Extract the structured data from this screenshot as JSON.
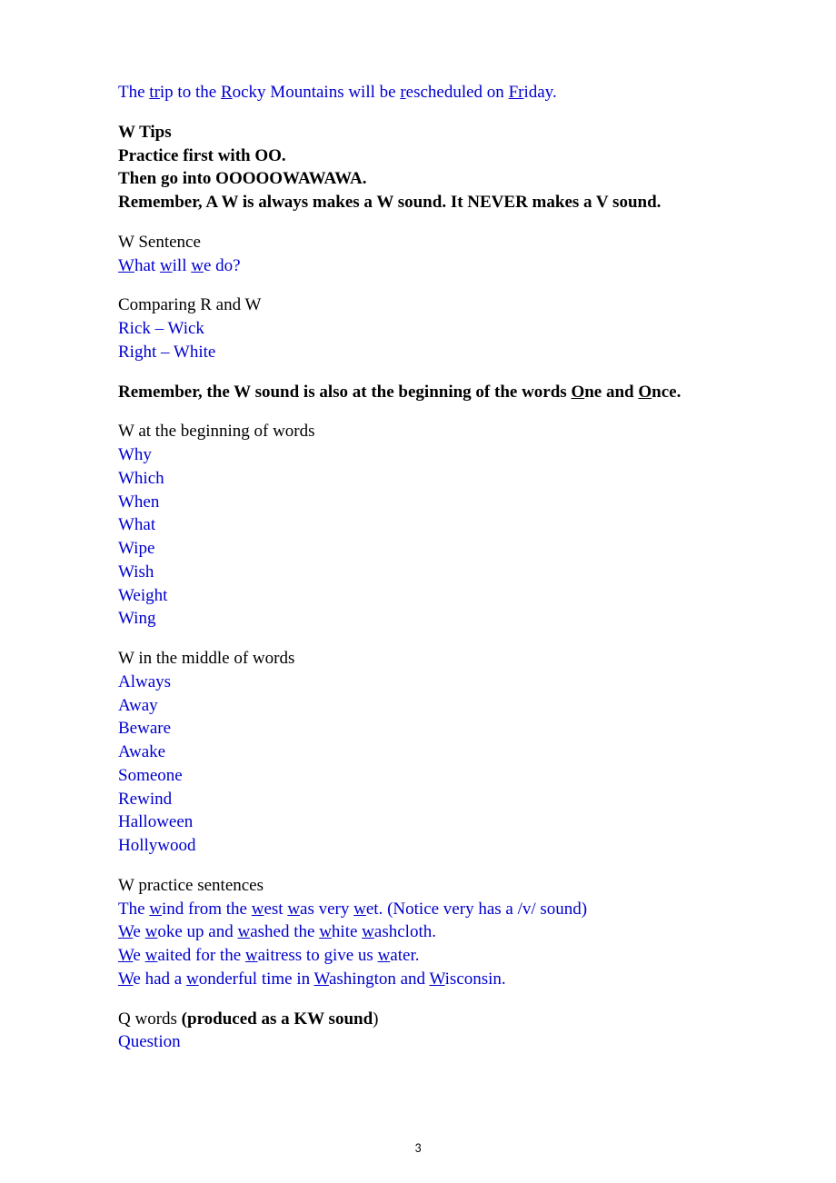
{
  "top_sentence": {
    "pre": "The ",
    "u1": "tr",
    "mid1": "ip to the ",
    "u2": "R",
    "mid2": "ocky Mountains will be ",
    "u3": "r",
    "mid3": "escheduled on ",
    "u4": "Fr",
    "mid4": "iday."
  },
  "w_tips": {
    "heading": "W Tips",
    "line1": "Practice first with OO.",
    "line2": "Then go into OOOOOWAWAWA.",
    "line3": "Remember, A W is always makes a W sound. It NEVER makes a V sound."
  },
  "w_sentence": {
    "heading": "W Sentence",
    "u1": "W",
    "t1": "hat ",
    "u2": "w",
    "t2": "ill ",
    "u3": "w",
    "t3": "e do?"
  },
  "comparing": {
    "heading": "Comparing R and W",
    "line1": "Rick – Wick",
    "line2": "Right – White"
  },
  "remember_w": {
    "pre": "Remember, the W sound is also at the beginning of the words ",
    "u1": "O",
    "mid1": "ne and ",
    "u2": "O",
    "mid2": "nce."
  },
  "w_beginning": {
    "heading": "W at the beginning of words",
    "words": [
      "Why",
      "Which",
      "When",
      "What",
      "Wipe",
      "Wish",
      "Weight",
      "Wing"
    ]
  },
  "w_middle": {
    "heading": "W in the middle of words",
    "words": [
      "Always",
      "Away",
      "Beware",
      "Awake",
      "Someone",
      "Rewind",
      "Halloween",
      "Hollywood"
    ]
  },
  "w_practice": {
    "heading": "W practice sentences",
    "s1": {
      "pre": "The ",
      "u1": "w",
      "t1": "ind from the ",
      "u2": "w",
      "t2": "est ",
      "u3": "w",
      "t3": "as very ",
      "u4": "w",
      "t4": "et. (Notice very has a /v/ sound)"
    },
    "s2": {
      "u1": "W",
      "t1": "e ",
      "u2": "w",
      "t2": "oke up and ",
      "u3": "w",
      "t3": "ashed the ",
      "u4": "w",
      "t4": "hite ",
      "u5": "w",
      "t5": "ashcloth."
    },
    "s3": {
      "u1": "W",
      "t1": "e ",
      "u2": "w",
      "t2": "aited for the ",
      "u3": "w",
      "t3": "aitress to give us ",
      "u4": "w",
      "t4": "ater."
    },
    "s4": {
      "u1": "W",
      "t1": "e had a ",
      "u2": "w",
      "t2": "onderful time in ",
      "u3": "W",
      "t3": "ashington and ",
      "u4": "W",
      "t4": "isconsin."
    }
  },
  "q_words": {
    "pre": "Q words ",
    "bold": "(produced as a KW sound",
    "post": ")",
    "word": "Question"
  },
  "page_number": "3"
}
